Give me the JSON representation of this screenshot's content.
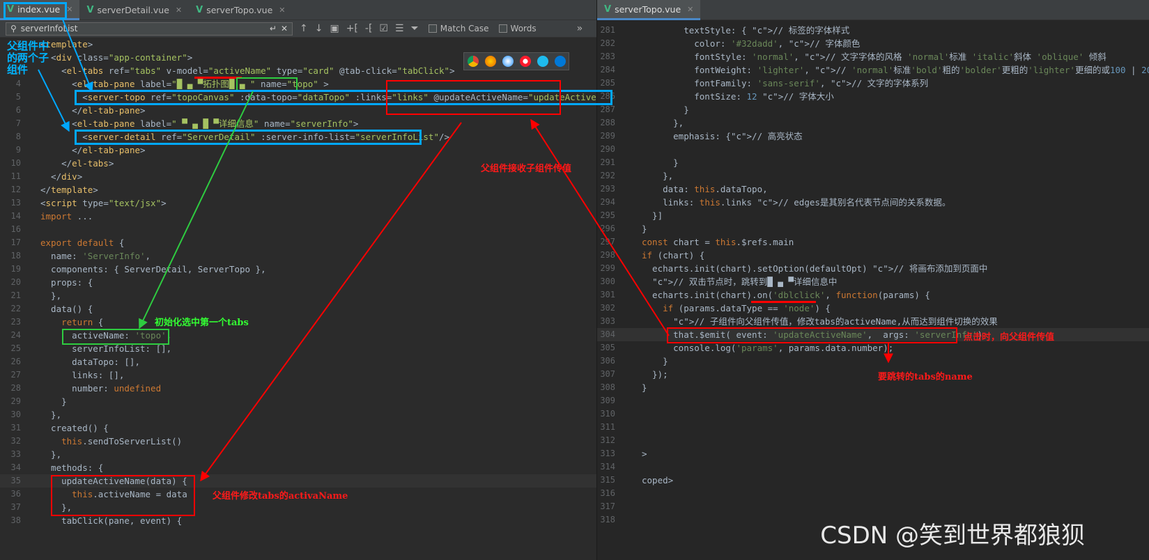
{
  "left_tabs": [
    {
      "label": "index.vue",
      "active": true
    },
    {
      "label": "serverDetail.vue",
      "active": false
    },
    {
      "label": "serverTopo.vue",
      "active": false
    }
  ],
  "right_tabs": [
    {
      "label": "serverTopo.vue",
      "active": true
    }
  ],
  "search": {
    "query": "serverInfoList",
    "match_case": "Match Case",
    "words": "Words"
  },
  "left_lines": [
    {
      "n": "1",
      "text": "<template>"
    },
    {
      "n": "2",
      "text": "  <div class=\"app-container\">"
    },
    {
      "n": "3",
      "text": "    <el-tabs ref=\"tabs\" v-model=\"activeName\" type=\"card\" @tab-click=\"tabClick\">"
    },
    {
      "n": "4",
      "text": "      <el-tab-pane label=\"█ ▄ ▀拓扑图█ ▄ \" name=\"topo\" >"
    },
    {
      "n": "5",
      "text": "        <server-topo ref=\"topoCanvas\" :data-topo=\"dataTopo\" :links=\"links\" @updateActiveName=\"updateActiveName\"></server"
    },
    {
      "n": "6",
      "text": "      </el-tab-pane>"
    },
    {
      "n": "7",
      "text": "      <el-tab-pane label=\" ▀ ▄ █ ▀详细信息\" name=\"serverInfo\">"
    },
    {
      "n": "8",
      "text": "        <server-detail ref=\"ServerDetail\" :server-info-list=\"serverInfoList\"/>"
    },
    {
      "n": "9",
      "text": "      </el-tab-pane>"
    },
    {
      "n": "10",
      "text": "    </el-tabs>"
    },
    {
      "n": "11",
      "text": "  </div>"
    },
    {
      "n": "12",
      "text": "</template>"
    },
    {
      "n": "13",
      "text": "<script type=\"text/jsx\">"
    },
    {
      "n": "14",
      "text": "import ..."
    },
    {
      "n": "16",
      "text": ""
    },
    {
      "n": "17",
      "text": "export default {"
    },
    {
      "n": "18",
      "text": "  name: 'ServerInfo',"
    },
    {
      "n": "19",
      "text": "  components: { ServerDetail, ServerTopo },"
    },
    {
      "n": "20",
      "text": "  props: {"
    },
    {
      "n": "21",
      "text": "  },"
    },
    {
      "n": "22",
      "text": "  data() {"
    },
    {
      "n": "23",
      "text": "    return {"
    },
    {
      "n": "24",
      "text": "      activeName: 'topo',"
    },
    {
      "n": "25",
      "text": "      serverInfoList: [],"
    },
    {
      "n": "26",
      "text": "      dataTopo: [],"
    },
    {
      "n": "27",
      "text": "      links: [],"
    },
    {
      "n": "28",
      "text": "      number: undefined"
    },
    {
      "n": "29",
      "text": "    }"
    },
    {
      "n": "30",
      "text": "  },"
    },
    {
      "n": "31",
      "text": "  created() {"
    },
    {
      "n": "32",
      "text": "    this.sendToServerList()"
    },
    {
      "n": "33",
      "text": "  },"
    },
    {
      "n": "34",
      "text": "  methods: {"
    },
    {
      "n": "35",
      "text": "    updateActiveName(data) {"
    },
    {
      "n": "36",
      "text": "      this.activeName = data"
    },
    {
      "n": "37",
      "text": "    },"
    },
    {
      "n": "38",
      "text": "    tabClick(pane, event) {"
    }
  ],
  "right_lines": [
    {
      "n": "281",
      "text": "        textStyle: { // 标签的字体样式"
    },
    {
      "n": "282",
      "text": "          color: '#32dadd', // 字体颜色"
    },
    {
      "n": "283",
      "text": "          fontStyle: 'normal', // 文字字体的风格 'normal'标准 'italic'斜体 'oblique' 倾斜"
    },
    {
      "n": "284",
      "text": "          fontWeight: 'lighter', // 'normal'标准'bold'粗的'bolder'更粗的'lighter'更细的或100 | 200"
    },
    {
      "n": "285",
      "text": "          fontFamily: 'sans-serif', // 文字的字体系列"
    },
    {
      "n": "286",
      "text": "          fontSize: 12 // 字体大小"
    },
    {
      "n": "287",
      "text": "        }"
    },
    {
      "n": "288",
      "text": "      },"
    },
    {
      "n": "289",
      "text": "      emphasis: {// 高亮状态"
    },
    {
      "n": "290",
      "text": ""
    },
    {
      "n": "291",
      "text": "      }"
    },
    {
      "n": "292",
      "text": "    },"
    },
    {
      "n": "293",
      "text": "    data: this.dataTopo,"
    },
    {
      "n": "294",
      "text": "    links: this.links // edges是其别名代表节点间的关系数据。"
    },
    {
      "n": "295",
      "text": "  }]"
    },
    {
      "n": "296",
      "text": "}"
    },
    {
      "n": "297",
      "text": "const chart = this.$refs.main"
    },
    {
      "n": "298",
      "text": "if (chart) {"
    },
    {
      "n": "299",
      "text": "  echarts.init(chart).setOption(defaultOpt) // 将画布添加到页面中"
    },
    {
      "n": "300",
      "text": "  // 双击节点时，跳转到█ ▄ ▀详细信息中"
    },
    {
      "n": "301",
      "text": "  echarts.init(chart).on('dblclick', function(params) {"
    },
    {
      "n": "302",
      "text": "    if (params.dataType == 'node') {"
    },
    {
      "n": "303",
      "text": "      // 子组件向父组件传值，修改tabs的activeName,从而达到组件切换的效果"
    },
    {
      "n": "304",
      "text": "      that.$emit( event: 'updateActiveName',  args: 'serverInfo')"
    },
    {
      "n": "305",
      "text": "      console.log('params', params.data.number);"
    },
    {
      "n": "306",
      "text": "    }"
    },
    {
      "n": "307",
      "text": "  });"
    },
    {
      "n": "308",
      "text": "}"
    },
    {
      "n": "309",
      "text": ""
    },
    {
      "n": "310",
      "text": ""
    },
    {
      "n": "311",
      "text": ""
    },
    {
      "n": "312",
      "text": ""
    },
    {
      "n": "313",
      "text": ">"
    },
    {
      "n": "314",
      "text": ""
    },
    {
      "n": "315",
      "text": "coped>"
    },
    {
      "n": "316",
      "text": ""
    },
    {
      "n": "317",
      "text": ""
    },
    {
      "n": "318",
      "text": ""
    }
  ],
  "annotations": {
    "two_child_components": "父组件中的两个子组件",
    "init_first_tab": "初始化选中第一个tabs",
    "parent_receives": "父组件接收子组件传值",
    "parent_modifies": "父组件修改tabs的activaName",
    "on_click_emit": "点击时，向父组件传值",
    "target_tab_name": "要跳转的tabs的name"
  },
  "watermark": "CSDN @笑到世界都狼狈",
  "colors": {
    "annotation_red": "#ff0000",
    "annotation_green": "#2ecc40",
    "annotation_blue": "#00a8ff",
    "vue_icon": "#41b883"
  }
}
